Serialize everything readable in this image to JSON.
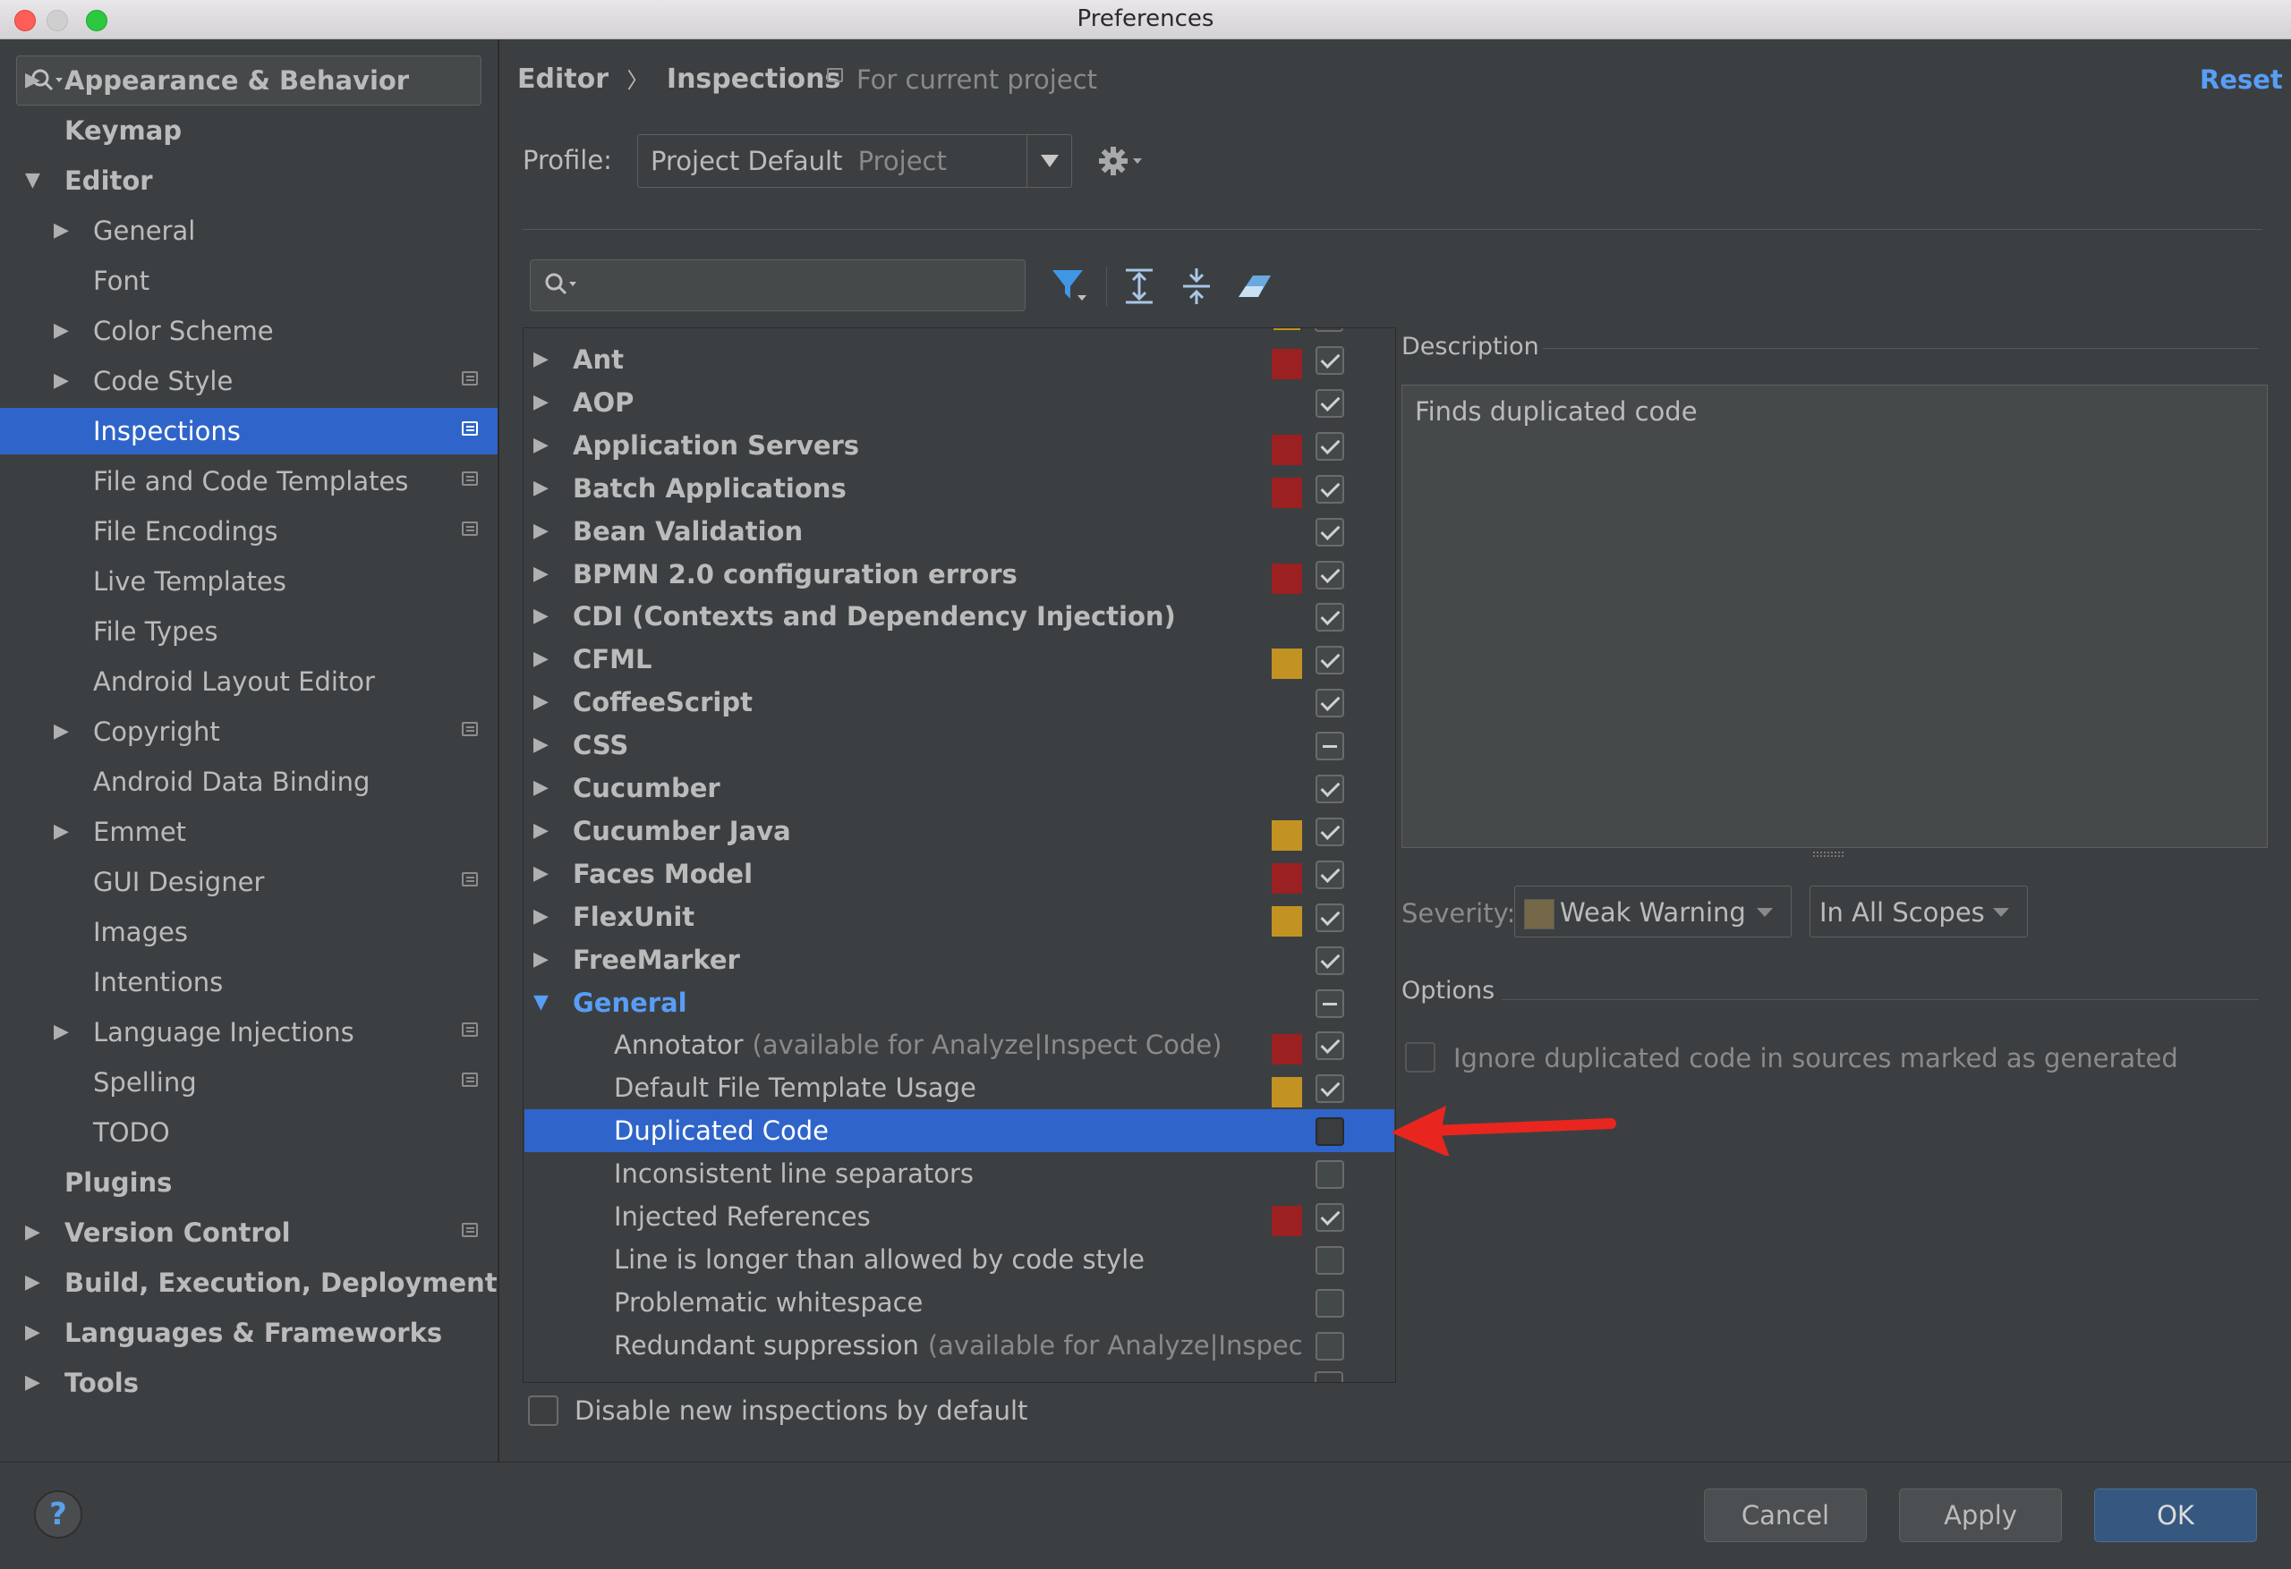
{
  "window": {
    "title": "Preferences"
  },
  "sidebar": {
    "items": [
      {
        "label": "Appearance & Behavior",
        "level": 0,
        "expand": "collapsed",
        "bold": true,
        "project_icon": false,
        "selected": false
      },
      {
        "label": "Keymap",
        "level": 0,
        "expand": "none",
        "bold": true,
        "project_icon": false,
        "selected": false
      },
      {
        "label": "Editor",
        "level": 0,
        "expand": "expanded",
        "bold": true,
        "project_icon": false,
        "selected": false
      },
      {
        "label": "General",
        "level": 1,
        "expand": "collapsed",
        "bold": false,
        "project_icon": false,
        "selected": false
      },
      {
        "label": "Font",
        "level": 1,
        "expand": "none",
        "bold": false,
        "project_icon": false,
        "selected": false
      },
      {
        "label": "Color Scheme",
        "level": 1,
        "expand": "collapsed",
        "bold": false,
        "project_icon": false,
        "selected": false
      },
      {
        "label": "Code Style",
        "level": 1,
        "expand": "collapsed",
        "bold": false,
        "project_icon": true,
        "selected": false
      },
      {
        "label": "Inspections",
        "level": 1,
        "expand": "none",
        "bold": false,
        "project_icon": true,
        "selected": true
      },
      {
        "label": "File and Code Templates",
        "level": 1,
        "expand": "none",
        "bold": false,
        "project_icon": true,
        "selected": false
      },
      {
        "label": "File Encodings",
        "level": 1,
        "expand": "none",
        "bold": false,
        "project_icon": true,
        "selected": false
      },
      {
        "label": "Live Templates",
        "level": 1,
        "expand": "none",
        "bold": false,
        "project_icon": false,
        "selected": false
      },
      {
        "label": "File Types",
        "level": 1,
        "expand": "none",
        "bold": false,
        "project_icon": false,
        "selected": false
      },
      {
        "label": "Android Layout Editor",
        "level": 1,
        "expand": "none",
        "bold": false,
        "project_icon": false,
        "selected": false
      },
      {
        "label": "Copyright",
        "level": 1,
        "expand": "collapsed",
        "bold": false,
        "project_icon": true,
        "selected": false
      },
      {
        "label": "Android Data Binding",
        "level": 1,
        "expand": "none",
        "bold": false,
        "project_icon": false,
        "selected": false
      },
      {
        "label": "Emmet",
        "level": 1,
        "expand": "collapsed",
        "bold": false,
        "project_icon": false,
        "selected": false
      },
      {
        "label": "GUI Designer",
        "level": 1,
        "expand": "none",
        "bold": false,
        "project_icon": true,
        "selected": false
      },
      {
        "label": "Images",
        "level": 1,
        "expand": "none",
        "bold": false,
        "project_icon": false,
        "selected": false
      },
      {
        "label": "Intentions",
        "level": 1,
        "expand": "none",
        "bold": false,
        "project_icon": false,
        "selected": false
      },
      {
        "label": "Language Injections",
        "level": 1,
        "expand": "collapsed",
        "bold": false,
        "project_icon": true,
        "selected": false
      },
      {
        "label": "Spelling",
        "level": 1,
        "expand": "none",
        "bold": false,
        "project_icon": true,
        "selected": false
      },
      {
        "label": "TODO",
        "level": 1,
        "expand": "none",
        "bold": false,
        "project_icon": false,
        "selected": false
      },
      {
        "label": "Plugins",
        "level": 0,
        "expand": "none",
        "bold": true,
        "project_icon": false,
        "selected": false
      },
      {
        "label": "Version Control",
        "level": 0,
        "expand": "collapsed",
        "bold": true,
        "project_icon": true,
        "selected": false
      },
      {
        "label": "Build, Execution, Deployment",
        "level": 0,
        "expand": "collapsed",
        "bold": true,
        "project_icon": false,
        "selected": false
      },
      {
        "label": "Languages & Frameworks",
        "level": 0,
        "expand": "collapsed",
        "bold": true,
        "project_icon": false,
        "selected": false
      },
      {
        "label": "Tools",
        "level": 0,
        "expand": "collapsed",
        "bold": true,
        "project_icon": false,
        "selected": false
      }
    ]
  },
  "header": {
    "breadcrumb_1": "Editor",
    "breadcrumb_sep": "〉",
    "breadcrumb_2": "Inspections",
    "scope_note": "For current project",
    "reset_label": "Reset"
  },
  "profile": {
    "label": "Profile:",
    "value": "Project Default",
    "value_hint": "Project"
  },
  "inspections": {
    "rows": [
      {
        "label": "Ant",
        "hint": "",
        "kind": "category",
        "expand": "collapsed",
        "severity": "error",
        "check": "checked",
        "selected": false
      },
      {
        "label": "AOP",
        "hint": "",
        "kind": "category",
        "expand": "collapsed",
        "severity": "",
        "check": "checked",
        "selected": false
      },
      {
        "label": "Application Servers",
        "hint": "",
        "kind": "category",
        "expand": "collapsed",
        "severity": "error",
        "check": "checked",
        "selected": false
      },
      {
        "label": "Batch Applications",
        "hint": "",
        "kind": "category",
        "expand": "collapsed",
        "severity": "error",
        "check": "checked",
        "selected": false
      },
      {
        "label": "Bean Validation",
        "hint": "",
        "kind": "category",
        "expand": "collapsed",
        "severity": "",
        "check": "checked",
        "selected": false
      },
      {
        "label": "BPMN 2.0 configuration errors",
        "hint": "",
        "kind": "category",
        "expand": "collapsed",
        "severity": "error",
        "check": "checked",
        "selected": false
      },
      {
        "label": "CDI (Contexts and Dependency Injection)",
        "hint": "",
        "kind": "category",
        "expand": "collapsed",
        "severity": "",
        "check": "checked",
        "selected": false
      },
      {
        "label": "CFML",
        "hint": "",
        "kind": "category",
        "expand": "collapsed",
        "severity": "warning",
        "check": "checked",
        "selected": false
      },
      {
        "label": "CoffeeScript",
        "hint": "",
        "kind": "category",
        "expand": "collapsed",
        "severity": "",
        "check": "checked",
        "selected": false
      },
      {
        "label": "CSS",
        "hint": "",
        "kind": "category",
        "expand": "collapsed",
        "severity": "",
        "check": "partial",
        "selected": false
      },
      {
        "label": "Cucumber",
        "hint": "",
        "kind": "category",
        "expand": "collapsed",
        "severity": "",
        "check": "checked",
        "selected": false
      },
      {
        "label": "Cucumber Java",
        "hint": "",
        "kind": "category",
        "expand": "collapsed",
        "severity": "warning",
        "check": "checked",
        "selected": false
      },
      {
        "label": "Faces Model",
        "hint": "",
        "kind": "category",
        "expand": "collapsed",
        "severity": "error",
        "check": "checked",
        "selected": false
      },
      {
        "label": "FlexUnit",
        "hint": "",
        "kind": "category",
        "expand": "collapsed",
        "severity": "warning",
        "check": "checked",
        "selected": false
      },
      {
        "label": "FreeMarker",
        "hint": "",
        "kind": "category",
        "expand": "collapsed",
        "severity": "",
        "check": "checked",
        "selected": false
      },
      {
        "label": "General",
        "hint": "",
        "kind": "category-open",
        "expand": "expanded",
        "severity": "",
        "check": "partial",
        "selected": false
      },
      {
        "label": "Annotator",
        "hint": "(available for Analyze|Inspect Code)",
        "kind": "item",
        "expand": "none",
        "severity": "error",
        "check": "checked",
        "selected": false
      },
      {
        "label": "Default File Template Usage",
        "hint": "",
        "kind": "item",
        "expand": "none",
        "severity": "warning",
        "check": "checked",
        "selected": false
      },
      {
        "label": "Duplicated Code",
        "hint": "",
        "kind": "item",
        "expand": "none",
        "severity": "",
        "check": "unchecked",
        "selected": true
      },
      {
        "label": "Inconsistent line separators",
        "hint": "",
        "kind": "item",
        "expand": "none",
        "severity": "",
        "check": "unchecked",
        "selected": false
      },
      {
        "label": "Injected References",
        "hint": "",
        "kind": "item",
        "expand": "none",
        "severity": "error",
        "check": "checked",
        "selected": false
      },
      {
        "label": "Line is longer than allowed by code style",
        "hint": "",
        "kind": "item",
        "expand": "none",
        "severity": "",
        "check": "unchecked",
        "selected": false
      },
      {
        "label": "Problematic whitespace",
        "hint": "",
        "kind": "item",
        "expand": "none",
        "severity": "",
        "check": "unchecked",
        "selected": false
      },
      {
        "label": "Redundant suppression",
        "hint": "(available for Analyze|Inspec",
        "kind": "item",
        "expand": "none",
        "severity": "",
        "check": "unchecked",
        "selected": false
      }
    ],
    "disable_new_label": "Disable new inspections by default"
  },
  "description": {
    "title": "Description",
    "text": "Finds duplicated code"
  },
  "severity": {
    "label": "Severity:",
    "value": "Weak Warning",
    "scope_value": "In All Scopes"
  },
  "options": {
    "title": "Options",
    "ignore_generated_label": "Ignore duplicated code in sources marked as generated"
  },
  "footer": {
    "help_label": "?",
    "cancel_label": "Cancel",
    "apply_label": "Apply",
    "ok_label": "OK"
  },
  "colors": {
    "selection": "#2f65ca",
    "severity_error": "#9b2021",
    "severity_warning": "#c29322",
    "weak_warning": "#756848",
    "link": "#589df6",
    "annotation_arrow": "#e8261f"
  }
}
